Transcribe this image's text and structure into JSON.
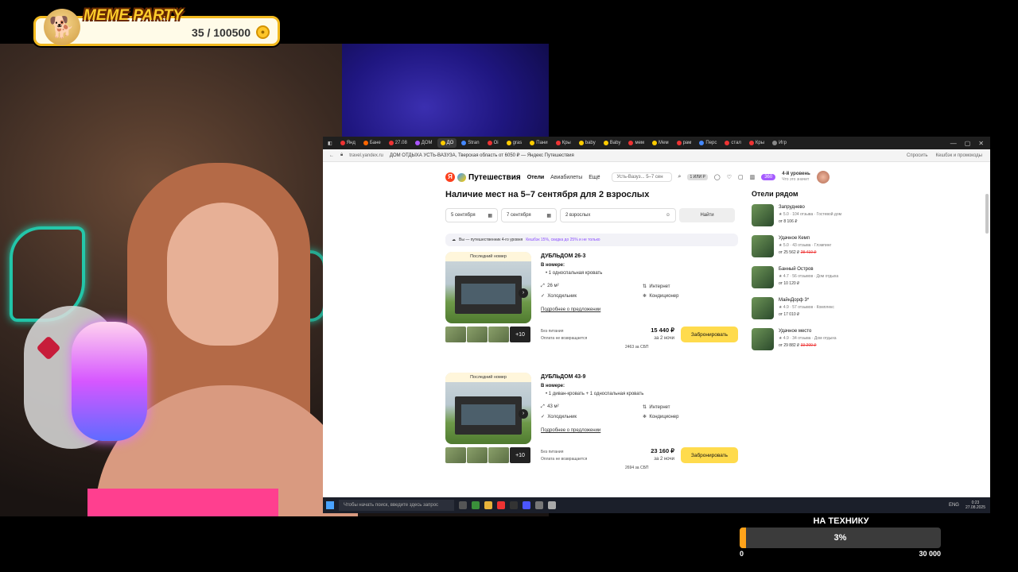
{
  "overlay": {
    "meme_title": "MEME PARTY",
    "meme_count": "35 / 100500",
    "goal_title": "НА ТЕХНИКУ",
    "goal_percent_label": "3%",
    "goal_progress": 0.03,
    "goal_min": "0",
    "goal_max": "30 000"
  },
  "browser": {
    "tabs": [
      "Янд",
      "Бане",
      "27.08",
      "ДОМ",
      "ДО",
      "Stran",
      "Oi",
      "gras",
      "Пани",
      "Кры",
      "baby",
      "Baby",
      "мем",
      "Мем",
      "рам",
      "Перс",
      "стал",
      "Кры",
      "Игр"
    ],
    "url": "travel.yandex.ru",
    "page_title": "ДОМ ОТДЫХА УСТЬ-ВАЗУЗА, Тверская область от 6050 ₽ — Яндекс Путешествия",
    "addr_right": [
      "Спросить",
      "Кешбэк и промокоды"
    ]
  },
  "page": {
    "logo": "Путешествия",
    "nav": [
      "Отели",
      "Авиабилеты",
      "Ещё"
    ],
    "header_search": "Усть-Вазуз... 5–7 сен",
    "plus_badge": "1 ИЛИ Р",
    "points": "360",
    "level_title": "4-й уровень",
    "level_sub": "Что это значит",
    "heading": "Наличие мест на 5–7 сентября для 2 взрослых",
    "checkin": "5 сентября",
    "checkout": "7 сентября",
    "guests": "2 взрослых",
    "find_button": "Найти",
    "promo_text": "Вы — путешественник 4-го уровня",
    "promo_link": "Кешбэк 15%, скидка до 25% и не только",
    "offers": [
      {
        "badge": "Последний номер",
        "name": "ДУБЛЬДОМ 26-3",
        "in_room_label": "В номере:",
        "bed": "1 односпальная кровать",
        "area": "26 м²",
        "fridge": "Холодильник",
        "internet": "Интернет",
        "ac": "Кондиционер",
        "more": "Подробнее о предложении",
        "thumbs_more": "+10",
        "meal": "Без питания",
        "refund": "Оплата не возвращается",
        "price": "15 440 ₽",
        "nights": "за 2 ночи",
        "sbp": "2463 за СБП",
        "book": "Забронировать"
      },
      {
        "badge": "Последний номер",
        "name": "ДУБЛЬДОМ 43-9",
        "in_room_label": "В номере:",
        "bed": "1 диван-кровать + 1 односпальная кровать",
        "area": "43 м²",
        "fridge": "Холодильник",
        "internet": "Интернет",
        "ac": "Кондиционер",
        "more": "Подробнее о предложении",
        "thumbs_more": "+10",
        "meal": "Без питания",
        "refund": "Оплата не возвращается",
        "price": "23 160 ₽",
        "nights": "за 2 ночи",
        "sbp": "2694 за СБП",
        "book": "Забронировать"
      }
    ],
    "nearby_title": "Отели рядом",
    "nearby": [
      {
        "name": "Запруднево",
        "rating": "★ 5.0",
        "reviews": "104 отзыва",
        "type": "Гостевой дом",
        "price": "от 8 106 ₽",
        "old": ""
      },
      {
        "name": "Удачное Кемп",
        "rating": "★ 5.0",
        "reviews": "43 отзыва",
        "type": "Глэмпинг",
        "price": "от 25 562 ₽",
        "old": "28 410 ₽"
      },
      {
        "name": "Банный Остров",
        "rating": "★ 4.7",
        "reviews": "56 отзывов",
        "type": "Дом отдыха",
        "price": "от 10 120 ₽",
        "old": ""
      },
      {
        "name": "МайнДорф 3*",
        "rating": "★ 4.9",
        "reviews": "57 отзывов",
        "type": "Комплекс",
        "price": "от 17 010 ₽",
        "old": ""
      },
      {
        "name": "Удачное место",
        "rating": "★ 4.9",
        "reviews": "34 отзыва",
        "type": "Дом отдыха",
        "price": "от 29 882 ₽",
        "old": "33 200 ₽"
      }
    ]
  },
  "taskbar": {
    "search_placeholder": "Чтобы начать поиск, введите здесь запрос",
    "lang": "ENG",
    "time": "0:23",
    "date": "27.08.2025"
  }
}
